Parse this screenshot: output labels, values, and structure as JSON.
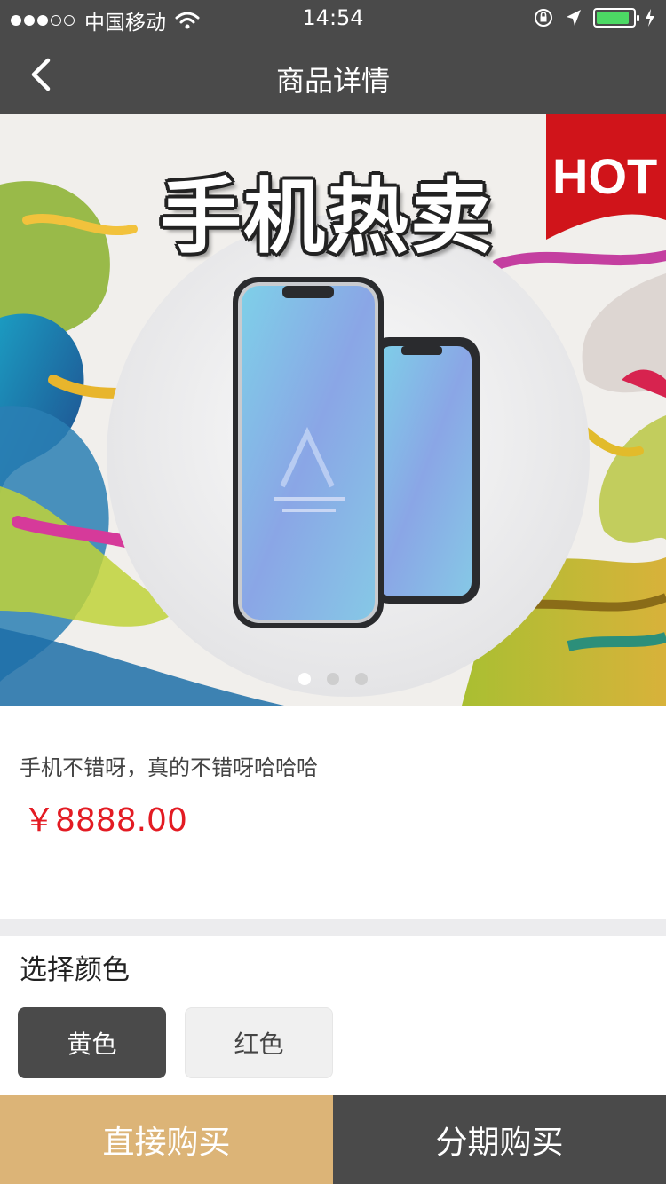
{
  "status_bar": {
    "signal_dots_filled": 3,
    "signal_dots_total": 5,
    "carrier": "中国移动",
    "time": "14:54",
    "battery_level": 0.9,
    "icons": [
      "wifi-icon",
      "rotation-lock-icon",
      "location-arrow-icon",
      "battery-icon",
      "charging-bolt-icon"
    ]
  },
  "nav": {
    "back_icon": "chevron-left-icon",
    "title": "商品详情"
  },
  "banner": {
    "headline": "手机热卖",
    "badge": "HOT",
    "slide_count": 3,
    "active_slide": 1,
    "colors": {
      "badge_red": "#d0141a"
    }
  },
  "product": {
    "description": "手机不错呀，真的不错呀哈哈哈",
    "price": "￥8888.00",
    "price_color": "#e31b23"
  },
  "color_selection": {
    "title": "选择颜色",
    "options": [
      {
        "label": "黄色",
        "selected": true
      },
      {
        "label": "红色",
        "selected": false
      }
    ]
  },
  "actions": {
    "buy_now": "直接购买",
    "installment": "分期购买",
    "buy_color": "#dcb477",
    "installment_color": "#4a4a4a"
  }
}
